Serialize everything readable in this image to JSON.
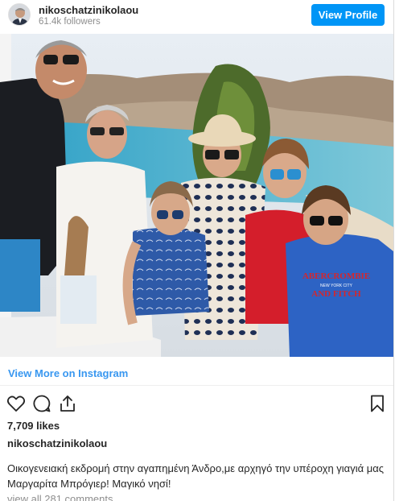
{
  "header": {
    "username": "nikoschatzinikolaou",
    "followers": "61.4k followers",
    "view_profile_label": "View Profile"
  },
  "photo": {
    "alt_icon": "family-photo",
    "shirt_print_line1": "ABERCROMBIE",
    "shirt_print_line2": "NEW YORK CITY",
    "shirt_print_line3": "AND FITCH"
  },
  "links": {
    "view_more": "View More on Instagram"
  },
  "actions": {
    "like_icon": "heart-icon",
    "comment_icon": "comment-icon",
    "share_icon": "share-icon",
    "save_icon": "bookmark-icon"
  },
  "post": {
    "likes": "7,709 likes",
    "owner": "nikoschatzinikolaou",
    "caption": "Οικογενειακή εκδρομή στην αγαπημένη Άνδρο,με αρχηγό την υπέροχη γιαγιά μας Μαργαρίτα Μπρόγιερ! Μαγικό νησί!",
    "comments_link": "view all 281 comments"
  },
  "colors": {
    "accent": "#0095f6",
    "link": "#3897f0",
    "muted": "#8e8e8e"
  }
}
